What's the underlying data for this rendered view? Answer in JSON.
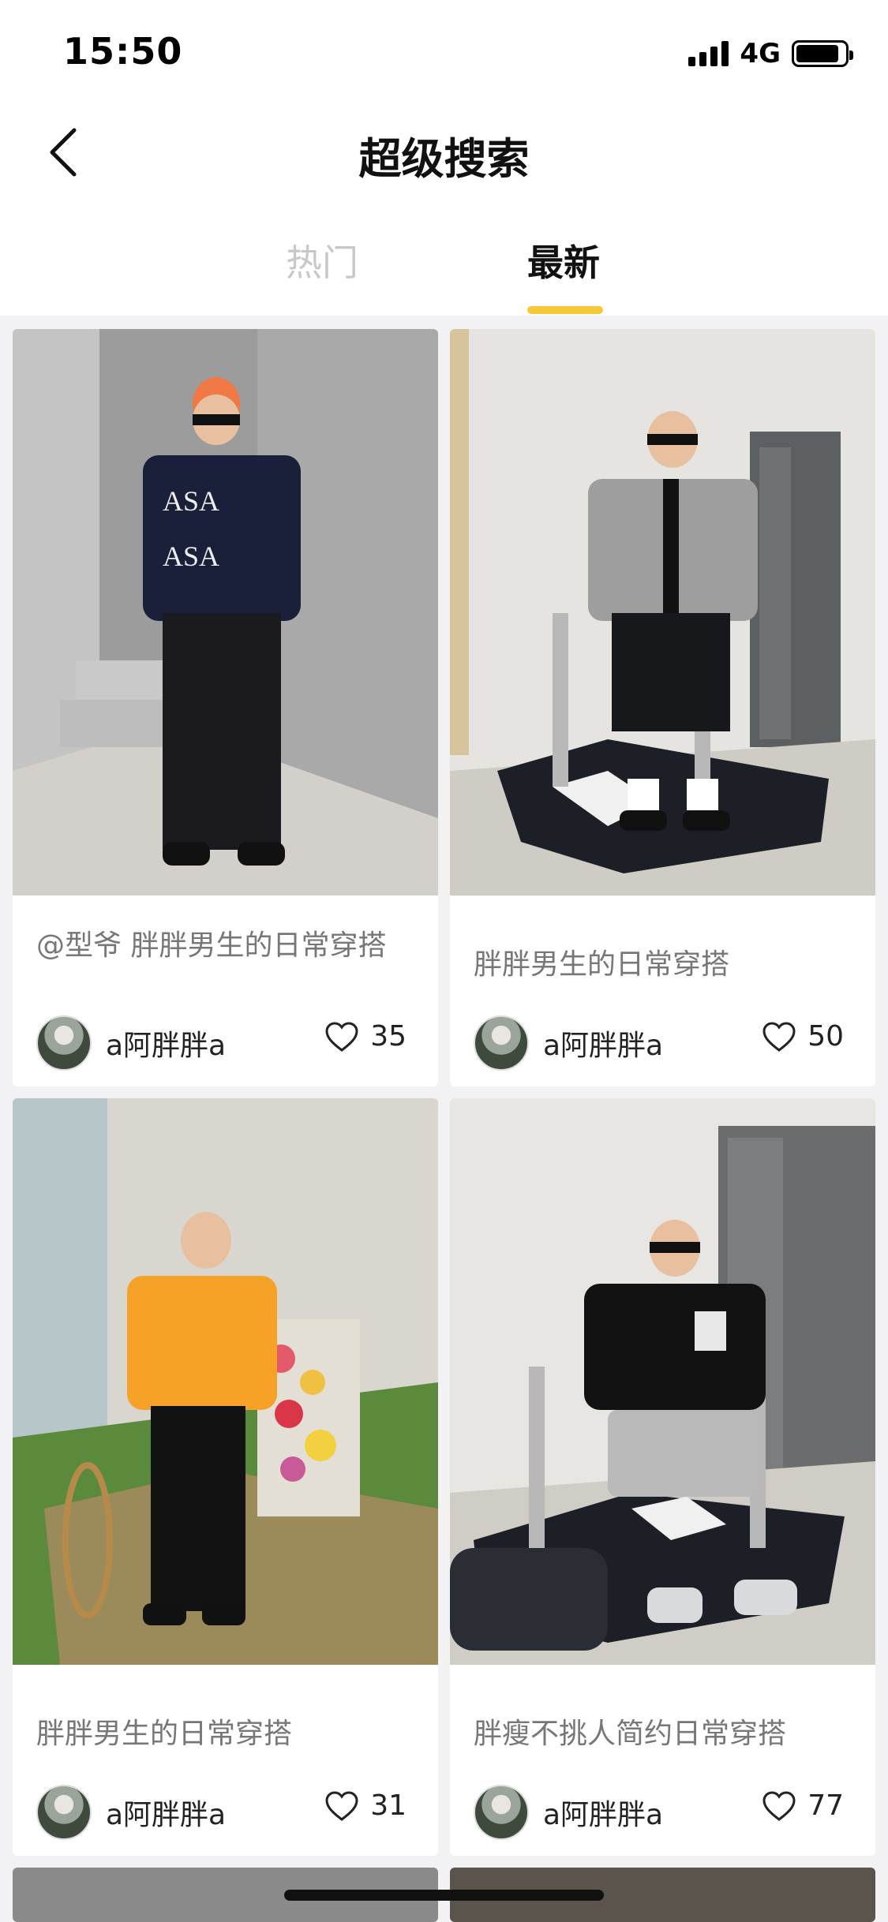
{
  "status": {
    "time": "15:50",
    "network": "4G"
  },
  "nav": {
    "title": "超级搜索"
  },
  "tabs": [
    {
      "label": "热门",
      "active": false
    },
    {
      "label": "最新",
      "active": true
    }
  ],
  "colors": {
    "accent": "#f7c73a",
    "inactive_tab": "#c8c8c8"
  },
  "cards": [
    {
      "title": "@型爷 胖胖男生的日常穿搭",
      "author": "a阿胖胖a",
      "likes": "35"
    },
    {
      "title": "胖胖男生的日常穿搭",
      "author": "a阿胖胖a",
      "likes": "50"
    },
    {
      "title": "胖胖男生的日常穿搭",
      "author": "a阿胖胖a",
      "likes": "31"
    },
    {
      "title": "胖瘦不挑人简约日常穿搭",
      "author": "a阿胖胖a",
      "likes": "77"
    }
  ]
}
